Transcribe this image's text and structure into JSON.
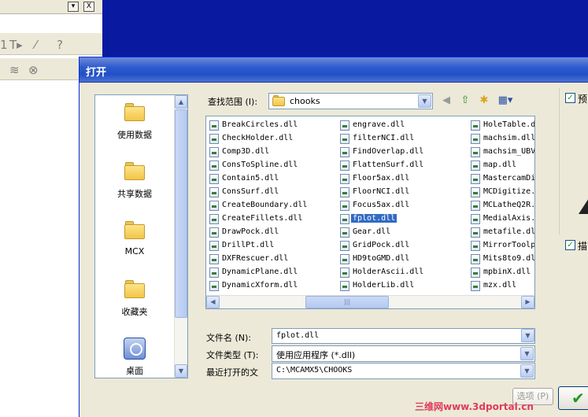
{
  "background_app": {
    "titlebar_buttons": [
      "▾",
      "X"
    ],
    "toolbar_row1_glyphs": [
      "1",
      "T▸",
      "⁄",
      "?"
    ],
    "toolbar_row2_glyphs": [
      "≋",
      "⊗"
    ]
  },
  "dialog": {
    "title": "打开",
    "look_in": {
      "label": "查找范围 (I):",
      "value": "chooks"
    },
    "toolbar_icons": [
      "back-icon",
      "up-folder-icon",
      "new-folder-icon",
      "view-menu-icon"
    ],
    "places": [
      {
        "label": "使用数据",
        "icon": "folder-icon"
      },
      {
        "label": "共享数据",
        "icon": "folder-icon"
      },
      {
        "label": "MCX",
        "icon": "folder-icon"
      },
      {
        "label": "收藏夹",
        "icon": "folder-icon"
      },
      {
        "label": "桌面",
        "icon": "desktop-icon"
      }
    ],
    "files": {
      "column1": [
        "BreakCircles.dll",
        "CheckHolder.dll",
        "Comp3D.dll",
        "ConsToSpline.dll",
        "Contain5.dll",
        "ConsSurf.dll",
        "CreateBoundary.dll",
        "CreateFillets.dll",
        "DrawPock.dll",
        "DrillPt.dll",
        "DXFRescuer.dll",
        "DynamicPlane.dll",
        "DynamicXform.dll"
      ],
      "column2": [
        "engrave.dll",
        "filterNCI.dll",
        "FindOverlap.dll",
        "FlattenSurf.dll",
        "Floor5ax.dll",
        "FloorNCI.dll",
        "Focus5ax.dll",
        "fplot.dll",
        "Gear.dll",
        "GridPock.dll",
        "HD9toGMD.dll",
        "HolderAscii.dll",
        "HolderLib.dll"
      ],
      "column3": [
        "HoleTable.d",
        "machsim.dll",
        "machsim_UBV",
        "map.dll",
        "MastercamDi",
        "MCDigitize.",
        "MCLatheQ2R.",
        "MedialAxis.",
        "metafile.dl",
        "MirrorToolp",
        "Mits8to9.dl",
        "mpbinX.dll",
        "mzx.dll"
      ],
      "selected": "fplot.dll"
    },
    "file_name": {
      "label": "文件名 (N):",
      "value": "fplot.dll"
    },
    "file_type": {
      "label": "文件类型 (T):",
      "value": "使用应用程序 (*.dll)"
    },
    "recent": {
      "label": "最近打开的文",
      "value": "C:\\MCAMX5\\CHOOKS"
    },
    "options_button": "选项 (P)",
    "right_checks": [
      "预",
      "描"
    ]
  },
  "watermark": "三维网www.3dportal.cn"
}
